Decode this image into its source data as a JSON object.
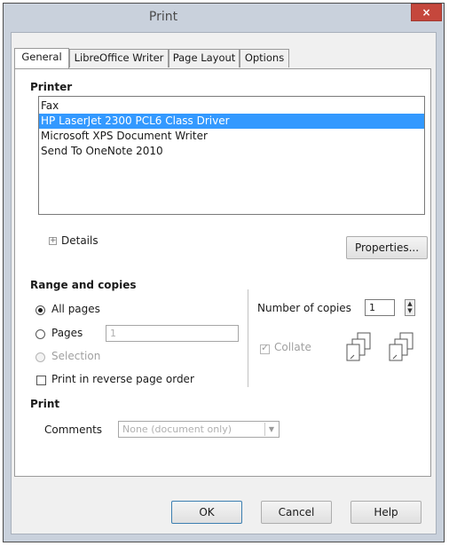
{
  "window": {
    "title": "Print",
    "close_glyph": "×"
  },
  "tabs": [
    {
      "label": "General"
    },
    {
      "label": "LibreOffice Writer"
    },
    {
      "label": "Page Layout"
    },
    {
      "label": "Options"
    }
  ],
  "printer": {
    "section_title": "Printer",
    "list": [
      "Fax",
      "HP LaserJet 2300 PCL6 Class Driver",
      "Microsoft XPS Document Writer",
      "Send To OneNote 2010"
    ],
    "selected_index": 1,
    "details_label": "Details",
    "properties_label": "Properties..."
  },
  "range": {
    "section_title": "Range and copies",
    "all_pages_label": "All pages",
    "pages_label": "Pages",
    "pages_value": "1",
    "selection_label": "Selection",
    "reverse_label": "Print in reverse page order",
    "copies_label": "Number of copies",
    "copies_value": "1",
    "collate_label": "Collate"
  },
  "print": {
    "section_title": "Print",
    "comments_label": "Comments",
    "comments_value": "None (document only)"
  },
  "buttons": {
    "ok": "OK",
    "cancel": "Cancel",
    "help": "Help"
  },
  "colors": {
    "selection": "#3399ff",
    "close": "#c5473c",
    "frame": "#c9d1dc"
  }
}
